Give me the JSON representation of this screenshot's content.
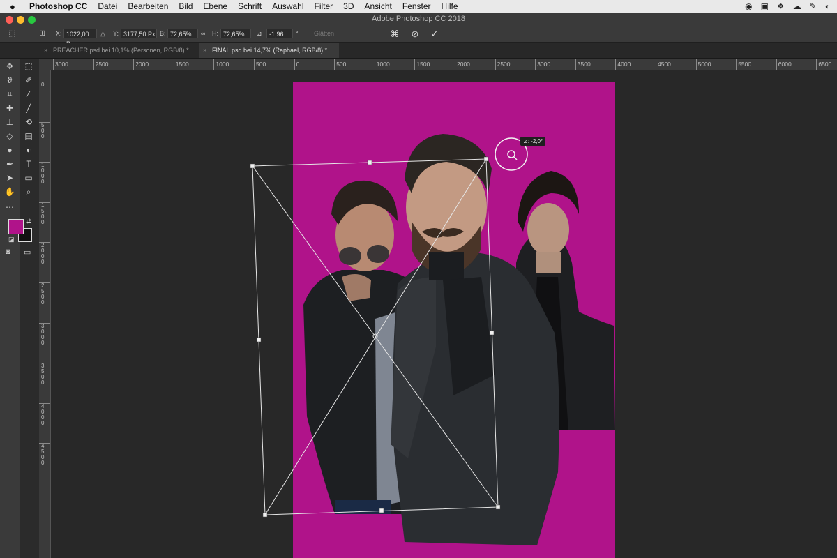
{
  "menubar": {
    "app_name": "Photoshop CC",
    "items": [
      "Datei",
      "Bearbeiten",
      "Bild",
      "Ebene",
      "Schrift",
      "Auswahl",
      "Filter",
      "3D",
      "Ansicht",
      "Fenster",
      "Hilfe"
    ]
  },
  "window": {
    "title": "Adobe Photoshop CC 2018"
  },
  "options": {
    "x_label": "X:",
    "x_value": "1022,00 Px",
    "y_label": "Y:",
    "y_value": "3177,50 Px",
    "w_label": "B:",
    "w_value": "72,65%",
    "h_label": "H:",
    "h_value": "72,65%",
    "angle_value": "-1,96",
    "angle_unit": "°",
    "smooth_label": "Glätten"
  },
  "tabs": [
    {
      "label": "PREACHER.psd bei 10,1% (Personen, RGB/8) *",
      "close": "×"
    },
    {
      "label": "FINAL.psd bei 14,7% (Raphael, RGB/8) *",
      "close": "×"
    }
  ],
  "ruler": {
    "h_labels": [
      "3000",
      "2500",
      "2000",
      "1500",
      "1000",
      "500",
      "0",
      "500",
      "1000",
      "1500",
      "2000",
      "2500",
      "3000",
      "3500",
      "4000",
      "4500",
      "5000",
      "5500",
      "6000",
      "6500"
    ],
    "v_labels": [
      "0",
      "500",
      "1000",
      "1500",
      "2000",
      "2500",
      "3000",
      "3500",
      "4000",
      "4500"
    ]
  },
  "canvas": {
    "rotation_readout": "⊿: -2,0°"
  },
  "colors": {
    "foreground": "#b0138a",
    "background": "#111111",
    "document_bg": "#b0138a"
  },
  "icons": {
    "move": "move-icon",
    "marquee": "rect-marquee-icon",
    "lasso": "lasso-icon",
    "quick_select": "quick-select-icon",
    "crop": "crop-icon",
    "eyedropper": "eyedropper-icon",
    "healing": "healing-brush-icon",
    "brush": "brush-icon",
    "stamp": "clone-stamp-icon",
    "history": "history-brush-icon",
    "eraser": "eraser-icon",
    "gradient": "gradient-icon",
    "blur": "blur-icon",
    "dodge": "dodge-icon",
    "pen": "pen-icon",
    "type": "type-icon",
    "path_select": "path-select-icon",
    "shape": "rectangle-shape-icon",
    "hand": "hand-icon",
    "zoom": "zoom-icon"
  }
}
